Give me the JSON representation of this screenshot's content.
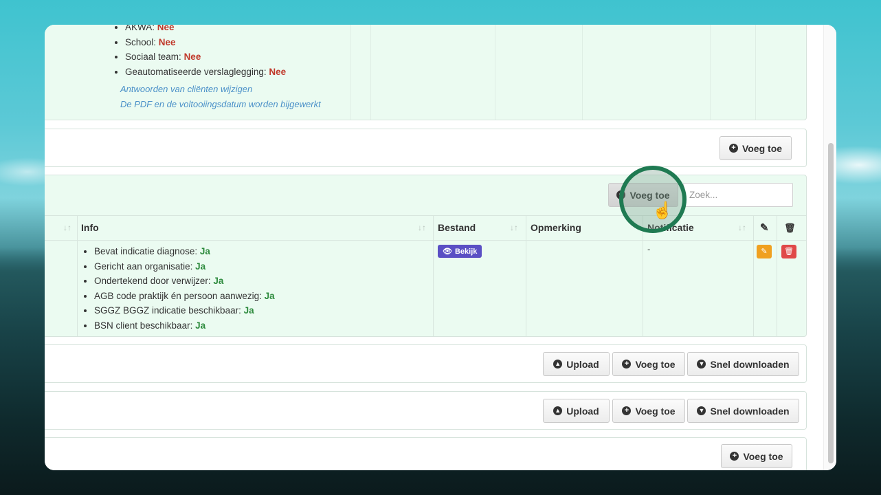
{
  "top_panel": {
    "items": [
      {
        "label": "AKWA:",
        "value": "Nee"
      },
      {
        "label": "School:",
        "value": "Nee"
      },
      {
        "label": "Sociaal team:",
        "value": "Nee"
      },
      {
        "label": "Geautomatiseerde verslaglegging:",
        "value": "Nee"
      }
    ],
    "link_1": "Antwoorden van cliënten wijzigen",
    "link_2": "De PDF en de voltooiingsdatum worden bijgewerkt"
  },
  "panel2": {
    "add_label": "Voeg toe"
  },
  "documents": {
    "add_label": "Voeg toe",
    "search_placeholder": "Zoek...",
    "columns": {
      "info": "Info",
      "bestand": "Bestand",
      "opmerking": "Opmerking",
      "notificatie": "Notificatie"
    },
    "row": {
      "info": [
        {
          "label": "Bevat indicatie diagnose:",
          "value": "Ja"
        },
        {
          "label": "Gericht aan organisatie:",
          "value": "Ja"
        },
        {
          "label": "Ondertekend door verwijzer:",
          "value": "Ja"
        },
        {
          "label": "AGB code praktijk én persoon aanwezig:",
          "value": "Ja"
        },
        {
          "label": "SGGZ BGGZ indicatie beschikbaar:",
          "value": "Ja"
        },
        {
          "label": "BSN client beschikbaar:",
          "value": "Ja"
        }
      ],
      "bestand_button": "Bekijk",
      "notificatie": "-"
    }
  },
  "panel4": {
    "upload": "Upload",
    "add": "Voeg toe",
    "download": "Snel downloaden"
  },
  "panel5": {
    "upload": "Upload",
    "add": "Voeg toe",
    "download": "Snel downloaden"
  },
  "panel6": {
    "add_label": "Voeg toe"
  },
  "colors": {
    "nee": "#c0392b",
    "ja": "#2e8b3e",
    "panel_green": "#ebfbf1",
    "highlight_ring": "#1f7a52",
    "bekijk": "#5a4fc4"
  }
}
